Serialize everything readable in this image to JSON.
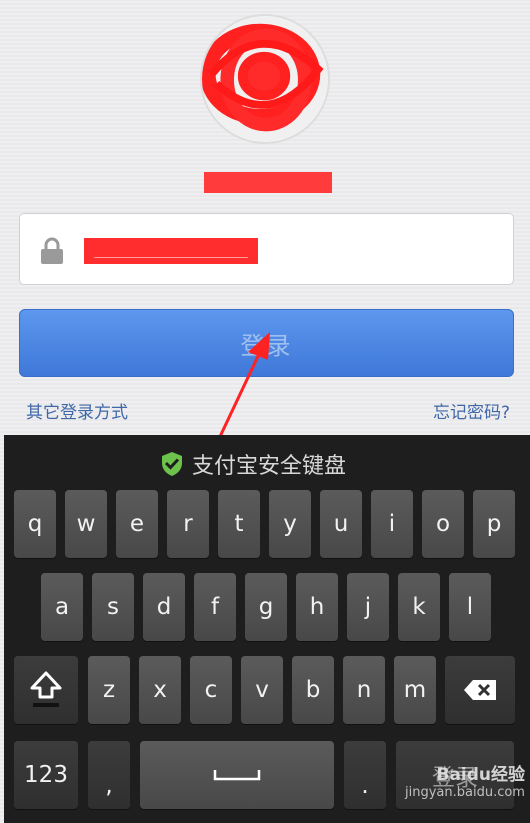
{
  "login": {
    "button_label": "登录",
    "other_methods": "其它登录方式",
    "forgot_password": "忘记密码?"
  },
  "keyboard": {
    "title": "支付宝安全键盘",
    "row1": [
      "q",
      "w",
      "e",
      "r",
      "t",
      "y",
      "u",
      "i",
      "o",
      "p"
    ],
    "row2": [
      "a",
      "s",
      "d",
      "f",
      "g",
      "h",
      "j",
      "k",
      "l"
    ],
    "row3": [
      "z",
      "x",
      "c",
      "v",
      "b",
      "n",
      "m"
    ],
    "numbers_key": "123",
    "comma_key": ",",
    "period_key": ".",
    "enter_key": "登录"
  },
  "watermark": {
    "brand": "Baidu经验",
    "url": "jingyan.baidu.com"
  },
  "colors": {
    "accent": "#4a86e8",
    "redaction": "#ff3333",
    "link": "#3f67a8",
    "shield": "#6cc24a"
  }
}
